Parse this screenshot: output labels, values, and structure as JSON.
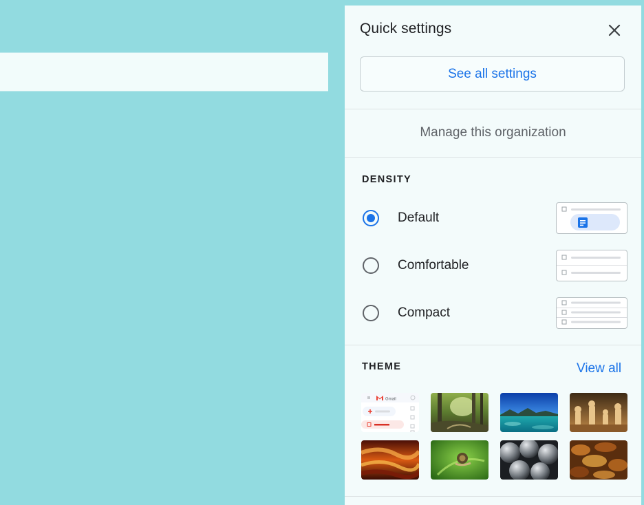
{
  "quick_settings": {
    "title": "Quick settings",
    "close_icon": "close-icon",
    "see_all_label": "See all settings",
    "manage_org_label": "Manage this organization"
  },
  "density": {
    "heading": "DENSITY",
    "options": [
      {
        "label": "Default",
        "selected": true
      },
      {
        "label": "Comfortable",
        "selected": false
      },
      {
        "label": "Compact",
        "selected": false
      }
    ]
  },
  "theme": {
    "heading": "THEME",
    "view_all_label": "View all",
    "thumbnails": [
      {
        "name": "default-gmail",
        "label": "Gmail"
      },
      {
        "name": "forest"
      },
      {
        "name": "lake"
      },
      {
        "name": "chess"
      },
      {
        "name": "canyon"
      },
      {
        "name": "snail-leaf"
      },
      {
        "name": "bubbles"
      },
      {
        "name": "autumn-leaves"
      }
    ]
  },
  "colors": {
    "accent": "#1a73e8",
    "page_background": "#92dbe0",
    "panel_background": "#f3fbfb"
  }
}
